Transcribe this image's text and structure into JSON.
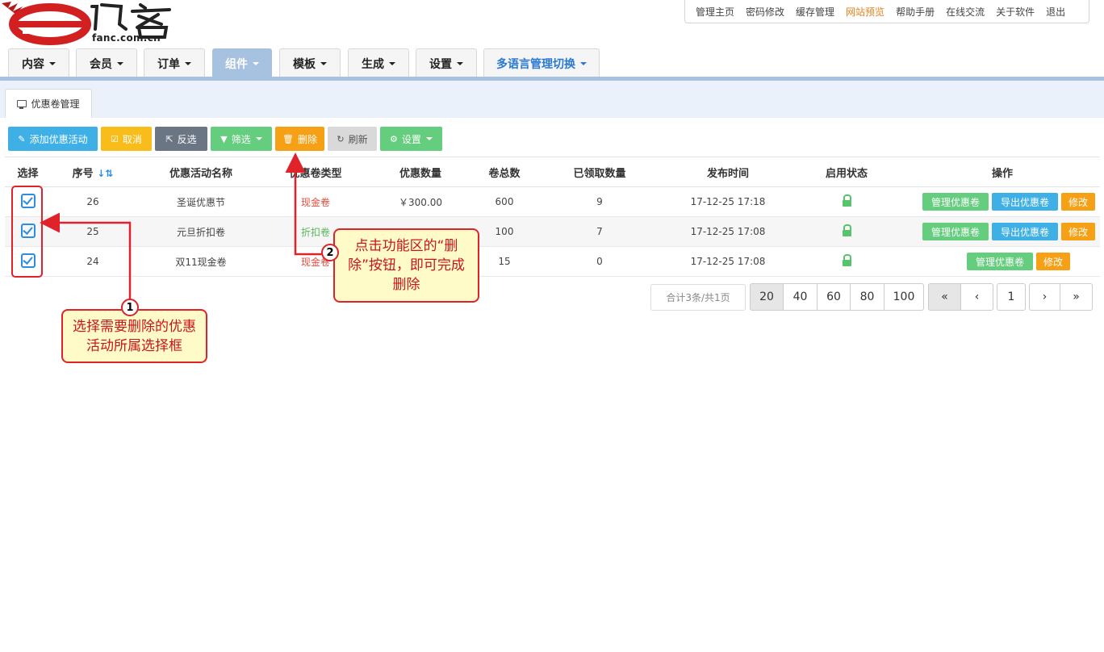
{
  "logo": {
    "url": "fanc.com.cn"
  },
  "topbar": [
    "管理主页",
    "密码修改",
    "缓存管理",
    "网站预览",
    "帮助手册",
    "在线交流",
    "关于软件",
    "退出"
  ],
  "nav": [
    {
      "label": "内容",
      "active": false
    },
    {
      "label": "会员",
      "active": false
    },
    {
      "label": "订单",
      "active": false
    },
    {
      "label": "组件",
      "active": true
    },
    {
      "label": "模板",
      "active": false
    },
    {
      "label": "生成",
      "active": false
    },
    {
      "label": "设置",
      "active": false
    },
    {
      "label": "多语言管理切换",
      "active": false
    }
  ],
  "subtab": "优惠卷管理",
  "toolbar": {
    "add": "添加优惠活动",
    "cancel": "取消",
    "invert": "反选",
    "filter": "筛选",
    "delete": "删除",
    "refresh": "刷新",
    "settings": "设置"
  },
  "table": {
    "headers": [
      "选择",
      "序号",
      "优惠活动名称",
      "优惠卷类型",
      "优惠数量",
      "卷总数",
      "已领取数量",
      "发布时间",
      "启用状态",
      "操作"
    ],
    "rows": [
      {
        "id": "26",
        "name": "圣诞优惠节",
        "type": "现金卷",
        "amount": "￥300.00",
        "total": "600",
        "claimed": "9",
        "time": "17-12-25 17:18",
        "actions": [
          "管理优惠卷",
          "导出优惠卷",
          "修改"
        ]
      },
      {
        "id": "25",
        "name": "元旦折扣卷",
        "type": "折扣卷",
        "amount": "",
        "total": "100",
        "claimed": "7",
        "time": "17-12-25 17:08",
        "actions": [
          "管理优惠卷",
          "导出优惠卷",
          "修改"
        ]
      },
      {
        "id": "24",
        "name": "双11现金卷",
        "type": "现金卷",
        "amount": "",
        "total": "15",
        "claimed": "0",
        "time": "17-12-25 17:08",
        "actions": [
          "管理优惠卷",
          "修改"
        ]
      }
    ]
  },
  "pagination": {
    "info": "合计3条/共1页",
    "sizes": [
      "20",
      "40",
      "60",
      "80",
      "100"
    ],
    "selected_size": "20",
    "page": "1"
  },
  "callouts": [
    {
      "num": "1",
      "text": "选择需要删除的优惠活动所属选择框"
    },
    {
      "num": "2",
      "text": "点击功能区的“删除”按钮，即可完成删除"
    }
  ],
  "colors": {
    "accent": "#a7c2e0",
    "annotation": "#e0222a",
    "blue": "#3fb0e6",
    "green": "#65cd7e",
    "orange": "#f6a015"
  }
}
